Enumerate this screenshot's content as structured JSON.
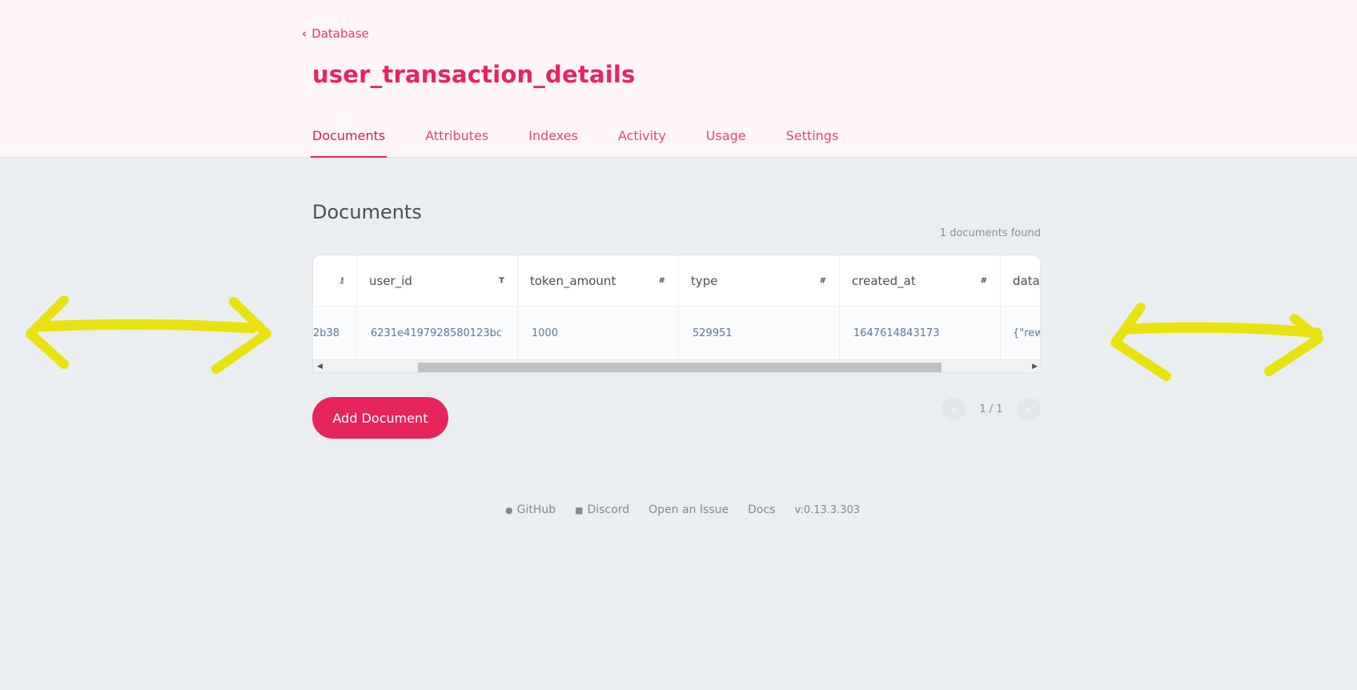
{
  "header": {
    "back_label": "Database",
    "title": "user_transaction_details",
    "tabs": [
      "Documents",
      "Attributes",
      "Indexes",
      "Activity",
      "Usage",
      "Settings"
    ],
    "active_tab": "Documents"
  },
  "main": {
    "section_title": "Documents",
    "found_count": "1 documents found",
    "table": {
      "columns": [
        {
          "name": "user_id",
          "type_icon": "T"
        },
        {
          "name": "token_amount",
          "type_icon": "#"
        },
        {
          "name": "type",
          "type_icon": "#"
        },
        {
          "name": "created_at",
          "type_icon": "#"
        },
        {
          "name": "data",
          "type_icon": ""
        }
      ],
      "rows": [
        {
          "id": "2b38",
          "user_id": "6231e4197928580123bc",
          "token_amount": "1000",
          "type": "529951",
          "created_at": "1647614843173",
          "data": "{\"rewa"
        }
      ]
    },
    "add_button": "Add Document",
    "pagination": "1 / 1"
  },
  "footer": {
    "github": "GitHub",
    "discord": "Discord",
    "issue": "Open an Issue",
    "docs": "Docs",
    "version": "v:0.13.3.303"
  },
  "colors": {
    "accent": "#e8245d",
    "annotation_arrow": "#e8e30f"
  }
}
